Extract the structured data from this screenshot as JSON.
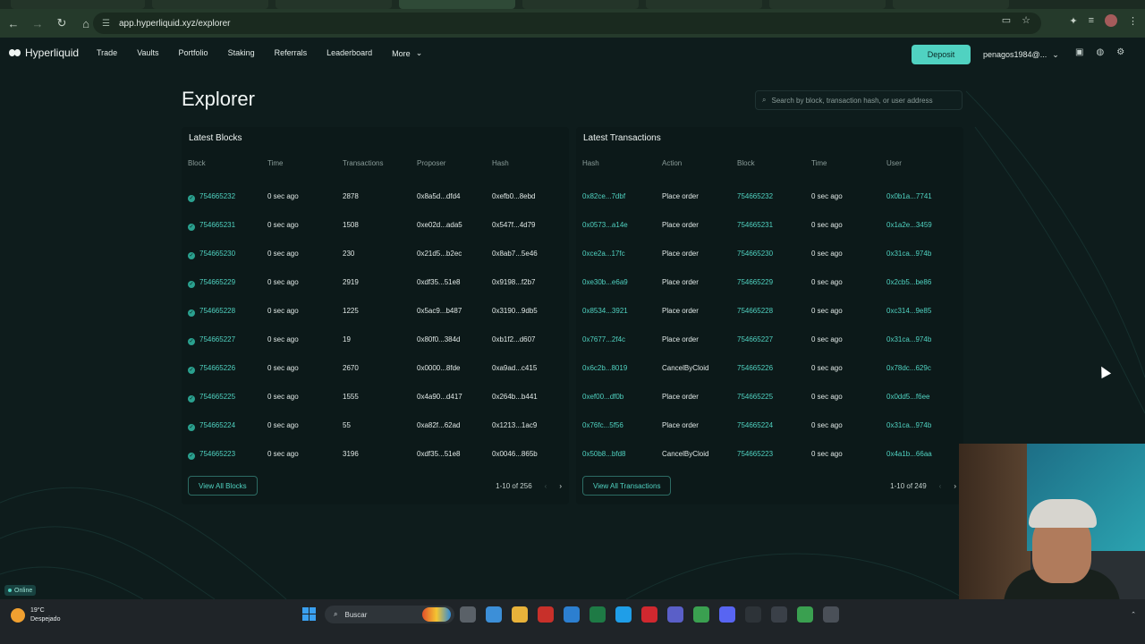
{
  "browser": {
    "url": "app.hyperliquid.xyz/explorer"
  },
  "nav": {
    "brand": "Hyperliquid",
    "items": [
      "Trade",
      "Vaults",
      "Portfolio",
      "Staking",
      "Referrals",
      "Leaderboard"
    ],
    "more_label": "More",
    "deposit_label": "Deposit",
    "account_label": "penagos1984@..."
  },
  "page": {
    "title": "Explorer",
    "search_placeholder": "Search by block, transaction hash, or user address"
  },
  "blocks": {
    "title": "Latest Blocks",
    "columns": [
      "Block",
      "Time",
      "Transactions",
      "Proposer",
      "Hash"
    ],
    "rows": [
      {
        "block": "754665232",
        "time": "0 sec ago",
        "txs": "2878",
        "proposer": "0x8a5d...dfd4",
        "hash": "0xefb0...8ebd"
      },
      {
        "block": "754665231",
        "time": "0 sec ago",
        "txs": "1508",
        "proposer": "0xe02d...ada5",
        "hash": "0x547f...4d79"
      },
      {
        "block": "754665230",
        "time": "0 sec ago",
        "txs": "230",
        "proposer": "0x21d5...b2ec",
        "hash": "0x8ab7...5e46"
      },
      {
        "block": "754665229",
        "time": "0 sec ago",
        "txs": "2919",
        "proposer": "0xdf35...51e8",
        "hash": "0x9198...f2b7"
      },
      {
        "block": "754665228",
        "time": "0 sec ago",
        "txs": "1225",
        "proposer": "0x5ac9...b487",
        "hash": "0x3190...9db5"
      },
      {
        "block": "754665227",
        "time": "0 sec ago",
        "txs": "19",
        "proposer": "0x80f0...384d",
        "hash": "0xb1f2...d607"
      },
      {
        "block": "754665226",
        "time": "0 sec ago",
        "txs": "2670",
        "proposer": "0x0000...8fde",
        "hash": "0xa9ad...c415"
      },
      {
        "block": "754665225",
        "time": "0 sec ago",
        "txs": "1555",
        "proposer": "0x4a90...d417",
        "hash": "0x264b...b441"
      },
      {
        "block": "754665224",
        "time": "0 sec ago",
        "txs": "55",
        "proposer": "0xa82f...62ad",
        "hash": "0x1213...1ac9"
      },
      {
        "block": "754665223",
        "time": "0 sec ago",
        "txs": "3196",
        "proposer": "0xdf35...51e8",
        "hash": "0x0046...865b"
      }
    ],
    "view_all_label": "View All Blocks",
    "pagination": "1-10 of 256"
  },
  "transactions": {
    "title": "Latest Transactions",
    "columns": [
      "Hash",
      "Action",
      "Block",
      "Time",
      "User"
    ],
    "rows": [
      {
        "hash": "0x82ce...7dbf",
        "action": "Place order",
        "block": "754665232",
        "time": "0 sec ago",
        "user": "0x0b1a...7741"
      },
      {
        "hash": "0x0573...a14e",
        "action": "Place order",
        "block": "754665231",
        "time": "0 sec ago",
        "user": "0x1a2e...3459"
      },
      {
        "hash": "0xce2a...17fc",
        "action": "Place order",
        "block": "754665230",
        "time": "0 sec ago",
        "user": "0x31ca...974b"
      },
      {
        "hash": "0xe30b...e6a9",
        "action": "Place order",
        "block": "754665229",
        "time": "0 sec ago",
        "user": "0x2cb5...be86"
      },
      {
        "hash": "0x8534...3921",
        "action": "Place order",
        "block": "754665228",
        "time": "0 sec ago",
        "user": "0xc314...9e85"
      },
      {
        "hash": "0x7677...2f4c",
        "action": "Place order",
        "block": "754665227",
        "time": "0 sec ago",
        "user": "0x31ca...974b"
      },
      {
        "hash": "0x6c2b...8019",
        "action": "CancelByCloid",
        "block": "754665226",
        "time": "0 sec ago",
        "user": "0x78dc...629c"
      },
      {
        "hash": "0xef00...df0b",
        "action": "Place order",
        "block": "754665225",
        "time": "0 sec ago",
        "user": "0x0dd5...f6ee"
      },
      {
        "hash": "0x76fc...5f56",
        "action": "Place order",
        "block": "754665224",
        "time": "0 sec ago",
        "user": "0x31ca...974b"
      },
      {
        "hash": "0x50b8...bfd8",
        "action": "CancelByCloid",
        "block": "754665223",
        "time": "0 sec ago",
        "user": "0x4a1b...66aa"
      }
    ],
    "view_all_label": "View All Transactions",
    "pagination": "1-10 of 249"
  },
  "status": {
    "online_label": "Online"
  },
  "taskbar": {
    "weather_temp": "19°C",
    "weather_desc": "Despejado",
    "search_placeholder": "Buscar"
  },
  "colors": {
    "accent": "#50d2c1",
    "background": "#0e1c1c",
    "card": "#0c1919"
  }
}
